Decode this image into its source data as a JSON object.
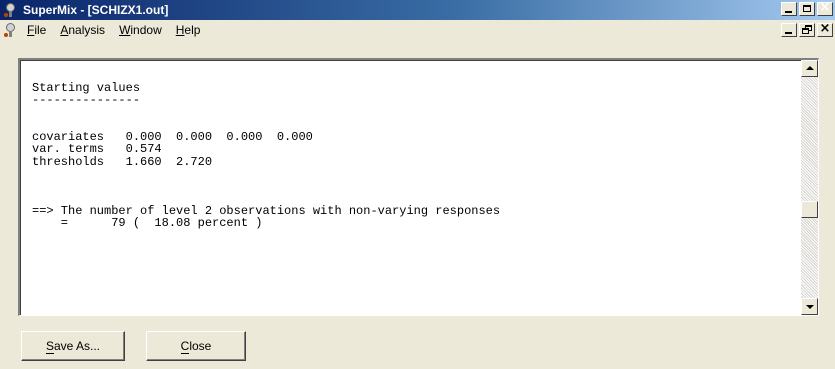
{
  "window": {
    "title": "SuperMix - [SCHIZX1.out]"
  },
  "menu": {
    "items": [
      {
        "mnemonic": "F",
        "rest": "ile"
      },
      {
        "mnemonic": "A",
        "rest": "nalysis"
      },
      {
        "mnemonic": "W",
        "rest": "indow"
      },
      {
        "mnemonic": "H",
        "rest": "elp"
      }
    ]
  },
  "output": {
    "text": "Starting values\n---------------\n\n\ncovariates   0.000  0.000  0.000  0.000\nvar. terms   0.574\nthresholds   1.660  2.720\n\n\n\n==> The number of level 2 observations with non-varying responses\n    =      79 (  18.08 percent )"
  },
  "buttons": {
    "save": {
      "mnemonic": "S",
      "rest": "ave As..."
    },
    "close": {
      "mnemonic": "C",
      "rest": "lose"
    }
  },
  "icons": {
    "app": "lightbulb-icon",
    "minimize": "minimize-icon",
    "maximize": "maximize-icon",
    "restore": "restore-icon",
    "close": "close-icon"
  }
}
